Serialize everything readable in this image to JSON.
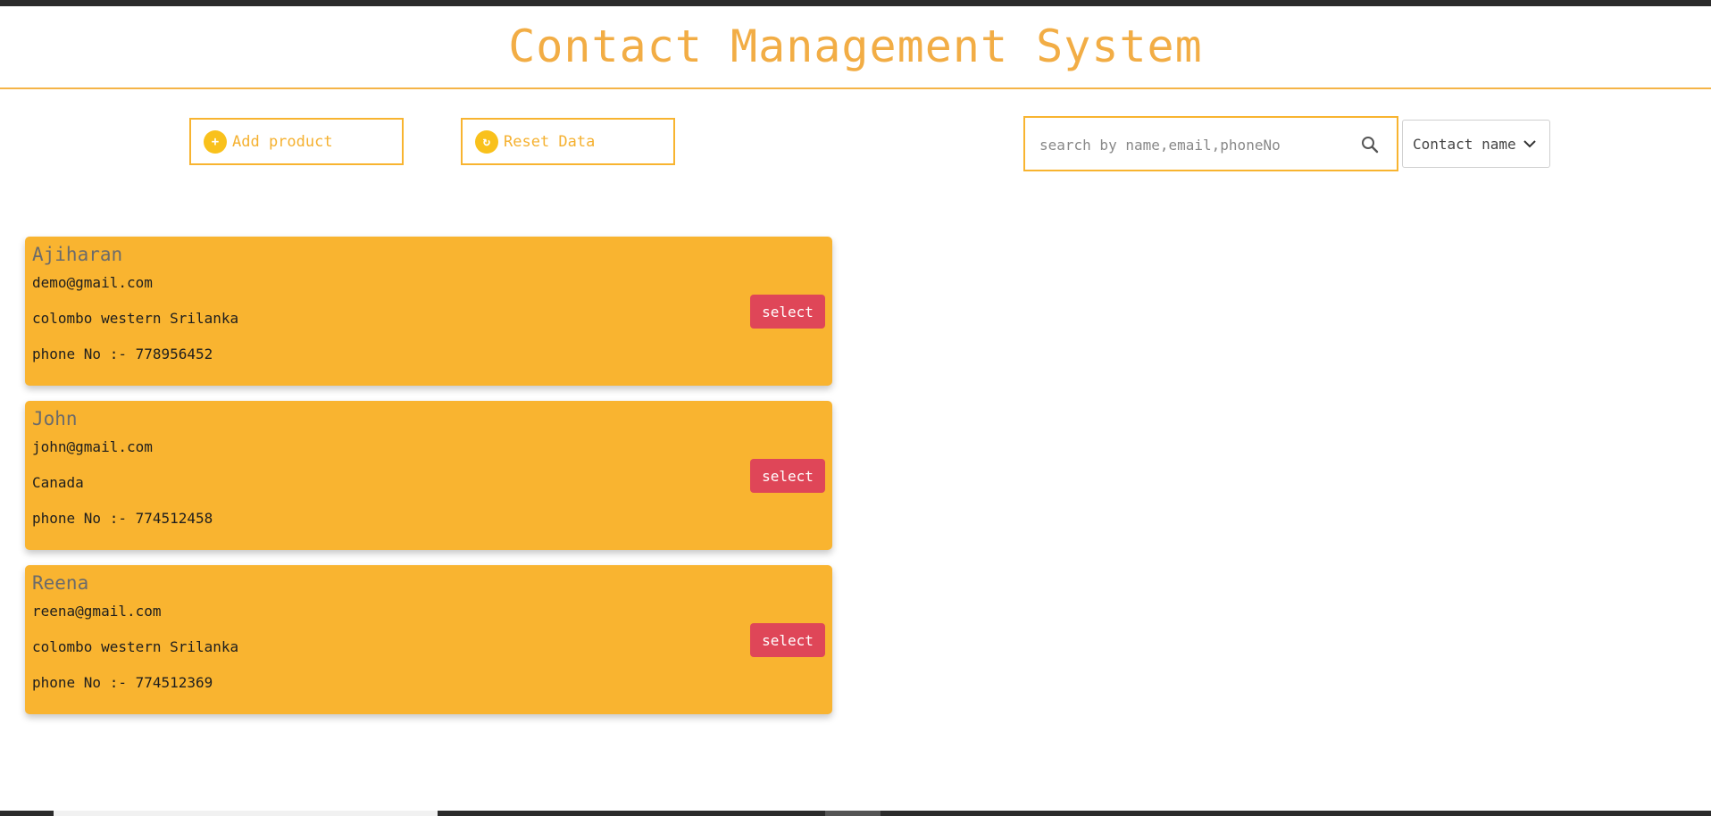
{
  "app": {
    "title": "Contact Management System"
  },
  "toolbar": {
    "add_label": "Add product",
    "reset_label": "Reset Data",
    "search_placeholder": "search by name,email,phoneNo",
    "sort_selected": "Contact name"
  },
  "contacts": [
    {
      "name": "Ajiharan",
      "email": "demo@gmail.com",
      "address": "colombo western Srilanka",
      "phone": "phone No :- 778956452",
      "button": "select"
    },
    {
      "name": "John",
      "email": "john@gmail.com",
      "address": "Canada",
      "phone": "phone No :- 774512458",
      "button": "select"
    },
    {
      "name": "Reena",
      "email": "reena@gmail.com",
      "address": "colombo western Srilanka",
      "phone": "phone No :- 774512369",
      "button": "select"
    }
  ],
  "icons": {
    "add": "plus-circle-icon",
    "reset": "refresh-circle-icon",
    "search": "search-icon",
    "dropdown": "chevron-down-icon"
  },
  "colors": {
    "accent": "#f9b430",
    "button": "#df4658",
    "title": "#f2ad45"
  }
}
